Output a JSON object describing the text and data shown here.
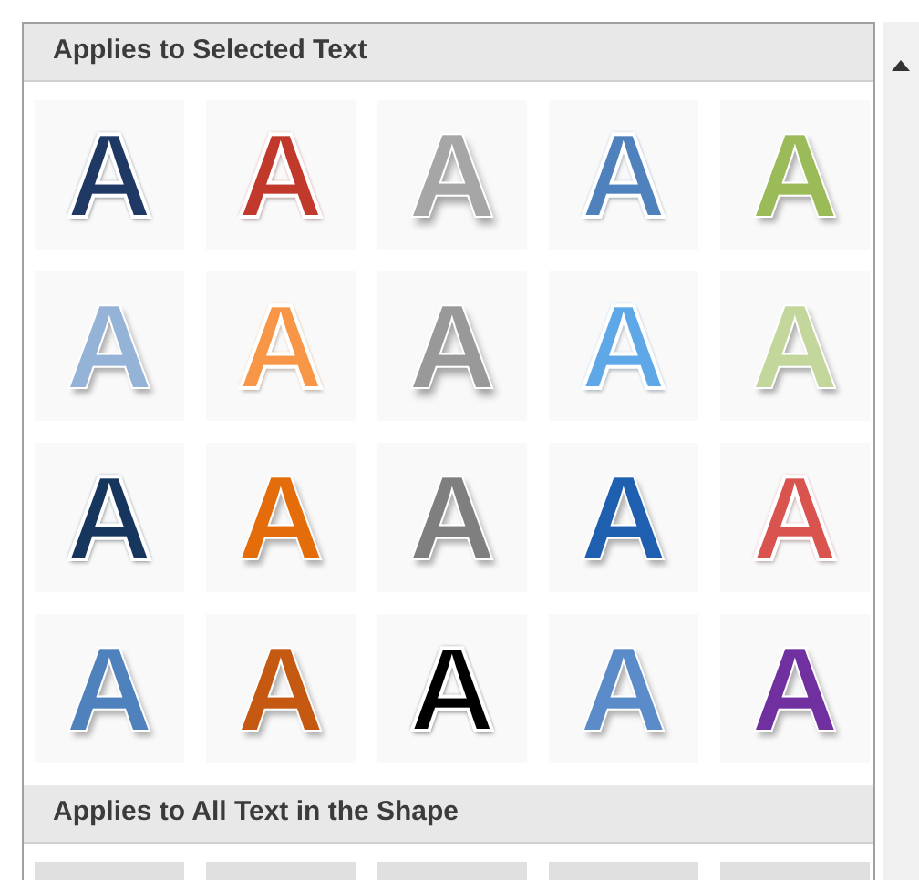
{
  "sections": [
    {
      "title": "Applies to Selected Text",
      "tiles": [
        {
          "label": "A",
          "kind": "outline",
          "color": "#1f3864"
        },
        {
          "label": "A",
          "kind": "outline",
          "color": "#c0392b"
        },
        {
          "label": "A",
          "kind": "shadow",
          "color": "#a6a6a6"
        },
        {
          "label": "A",
          "kind": "outline",
          "color": "#4f81bd"
        },
        {
          "label": "A",
          "kind": "fill",
          "color": "#9bbb59"
        },
        {
          "label": "A",
          "kind": "fill",
          "color": "#95b3d7"
        },
        {
          "label": "A",
          "kind": "outline",
          "color": "#f79646"
        },
        {
          "label": "A",
          "kind": "shadow",
          "color": "#999999"
        },
        {
          "label": "A",
          "kind": "outline",
          "color": "#5fa8e8"
        },
        {
          "label": "A",
          "kind": "fill",
          "color": "#c3d69b"
        },
        {
          "label": "A",
          "kind": "outline",
          "color": "#17365d"
        },
        {
          "label": "A",
          "kind": "fill",
          "color": "#e46c0a"
        },
        {
          "label": "A",
          "kind": "fill",
          "color": "#7f7f7f"
        },
        {
          "label": "A",
          "kind": "fill",
          "color": "#1f5fb0"
        },
        {
          "label": "A",
          "kind": "outline",
          "color": "#d9534f"
        },
        {
          "label": "A",
          "kind": "fill",
          "color": "#4f81bd"
        },
        {
          "label": "A",
          "kind": "fill",
          "color": "#c65911"
        },
        {
          "label": "A",
          "kind": "outline",
          "color": "#000000"
        },
        {
          "label": "A",
          "kind": "fill",
          "color": "#5b8bc9"
        },
        {
          "label": "A",
          "kind": "fill",
          "color": "#7030a0"
        }
      ]
    },
    {
      "title": "Applies to All Text in the Shape",
      "tiles": [
        {
          "kind": "partial",
          "color": "#e0e0e0"
        },
        {
          "kind": "partial",
          "color": "#e0e0e0"
        },
        {
          "kind": "partial",
          "color": "#e0e0e0"
        },
        {
          "kind": "partial",
          "color": "#e0e0e0"
        },
        {
          "kind": "partial",
          "color": "#e0e0e0"
        }
      ]
    }
  ]
}
